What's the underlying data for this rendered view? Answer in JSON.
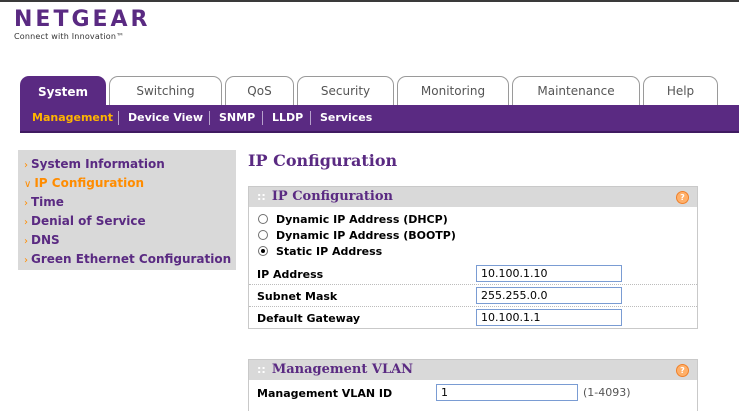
{
  "brand": {
    "name": "NETGEAR",
    "tagline": "Connect with Innovation™"
  },
  "main_tabs": [
    {
      "label": "System",
      "active": true
    },
    {
      "label": "Switching",
      "active": false
    },
    {
      "label": "QoS",
      "active": false
    },
    {
      "label": "Security",
      "active": false
    },
    {
      "label": "Monitoring",
      "active": false
    },
    {
      "label": "Maintenance",
      "active": false
    },
    {
      "label": "Help",
      "active": false
    }
  ],
  "sub_nav": [
    {
      "label": "Management",
      "active": true
    },
    {
      "label": "Device View",
      "active": false
    },
    {
      "label": "SNMP",
      "active": false
    },
    {
      "label": "LLDP",
      "active": false
    },
    {
      "label": "Services",
      "active": false
    }
  ],
  "left_nav": [
    {
      "label": "System Information",
      "active": false
    },
    {
      "label": "IP Configuration",
      "active": true
    },
    {
      "label": "Time",
      "active": false
    },
    {
      "label": "Denial of Service",
      "active": false
    },
    {
      "label": "DNS",
      "active": false
    },
    {
      "label": "Green Ethernet Configuration",
      "active": false
    }
  ],
  "page_title": "IP Configuration",
  "ip_panel": {
    "title": "IP Configuration",
    "radios": [
      {
        "label": "Dynamic IP Address (DHCP)",
        "checked": false
      },
      {
        "label": "Dynamic IP Address (BOOTP)",
        "checked": false
      },
      {
        "label": "Static IP Address",
        "checked": true
      }
    ],
    "fields": [
      {
        "label": "IP Address",
        "value": "10.100.1.10"
      },
      {
        "label": "Subnet Mask",
        "value": "255.255.0.0"
      },
      {
        "label": "Default Gateway",
        "value": "10.100.1.1"
      }
    ]
  },
  "vlan_panel": {
    "title": "Management VLAN",
    "field_label": "Management VLAN ID",
    "field_value": "1",
    "range_hint": "(1-4093)"
  },
  "icons": {
    "help": "help-icon",
    "arrow": "arrow-icon"
  },
  "colors": {
    "brand_purple": "#5a2a82",
    "active_orange": "#ff8c00"
  }
}
